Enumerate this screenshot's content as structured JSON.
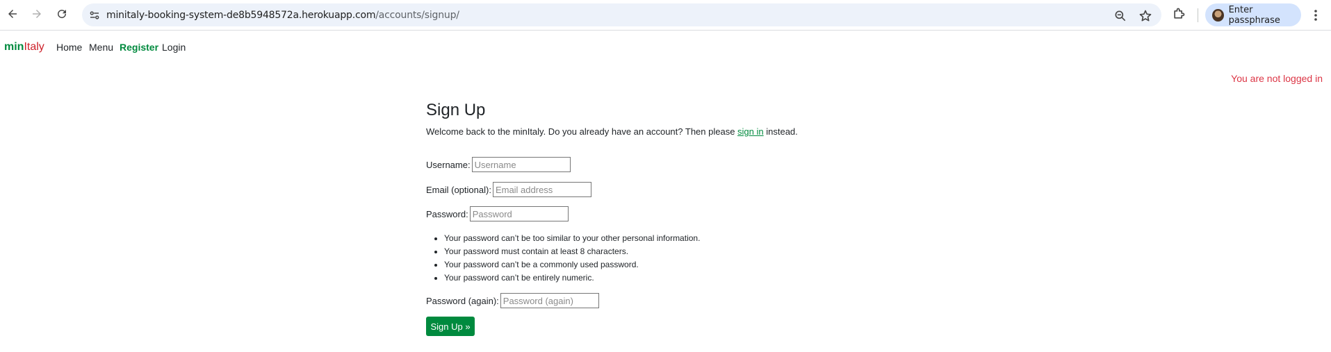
{
  "browser": {
    "url_host": "minitaly-booking-system-de8b5948572a.herokuapp.com",
    "url_path": "/accounts/signup/",
    "profile_label": "Enter passphrase",
    "icons": [
      "back-icon",
      "forward-icon",
      "reload-icon",
      "site-info-icon",
      "zoom-icon",
      "bookmark-star-icon",
      "extensions-icon",
      "more-menu-icon"
    ]
  },
  "site": {
    "brand_part1": "min",
    "brand_part2": "Italy",
    "nav": [
      "Home",
      "Menu",
      "Register",
      "Login"
    ],
    "active_nav": "Register",
    "login_status": "You are not logged in"
  },
  "signup": {
    "title": "Sign Up",
    "intro_before": "Welcome back to the minItaly. Do you already have an account? Then please ",
    "intro_link": "sign in",
    "intro_after": " instead.",
    "username_label": "Username:",
    "username_placeholder": "Username",
    "email_label": "Email (optional):",
    "email_placeholder": "Email address",
    "password_label": "Password:",
    "password_placeholder": "Password",
    "password_help": [
      "Your password can’t be too similar to your other personal information.",
      "Your password must contain at least 8 characters.",
      "Your password can’t be a commonly used password.",
      "Your password can’t be entirely numeric."
    ],
    "password2_label": "Password (again):",
    "password2_placeholder": "Password (again)",
    "submit_label": "Sign Up »"
  },
  "colors": {
    "brand_green": "#008a3e",
    "brand_red": "#cd212a",
    "status_red": "#dc3545"
  }
}
